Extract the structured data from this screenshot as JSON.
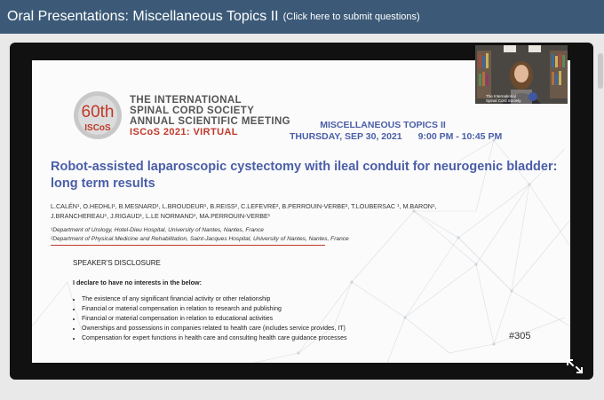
{
  "header": {
    "title": "Oral Presentations: Miscellaneous Topics II",
    "submit_link": "(Click here to submit questions)"
  },
  "slide": {
    "logo_number": "60th",
    "logo_text": "ISCoS",
    "org_line1": "THE INTERNATIONAL",
    "org_line2": "SPINAL CORD SOCIETY",
    "org_line3": "ANNUAL SCIENTIFIC MEETING",
    "org_line4": "ISCoS 2021: VIRTUAL",
    "session": "MISCELLANEOUS TOPICS II",
    "date": "THURSDAY, SEP 30, 2021",
    "time": "9:00 PM - 10:45 PM",
    "title": "Robot-assisted laparoscopic cystectomy with ileal conduit for neurogenic bladder: long term results",
    "authors_line1": "L.CALÉN¹, O.HEDHLI¹, B.MESNARD¹, L.BROUDEUR¹, B.REISS², C.LEFEVRE², B.PERROUIN-VERBE², T.LOUBERSAC ¹, M.BARON¹,",
    "authors_line2": "J.BRANCHEREAU¹, J.RIGAUD¹, L.LE NORMAND¹, MA.PERROUIN-VERBE¹",
    "affiliation1": "¹Department of Urology, Hotel-Dieu Hospital, University of Nantes, Nantes, France",
    "affiliation2": "²Department of Physical Medicine and Rehabilitation, Saint-Jacques Hospital, University of Nantes, Nantes, France",
    "disclosure_heading": "SPEAKER'S DISCLOSURE",
    "declaration": "I declare to have no interests in the below:",
    "bullets": [
      "The existence of any significant financial activity or other relationship",
      "Financial or material compensation  in relation to research and publishing",
      "Financial or material compensation  in relation to educational activities",
      "Ownerships and possessions in companies related to health care (includes service provides, IT)",
      "Compensation for expert functions in health care and consulting health care guidance processes"
    ],
    "abstract_number": "#305"
  },
  "webcam": {
    "caption_line1": "The International",
    "caption_line2": "Spinal Cord Society"
  },
  "colors": {
    "header_bg": "#3c5a78",
    "title_blue": "#4a5ea8",
    "accent_red": "#c0392b"
  }
}
